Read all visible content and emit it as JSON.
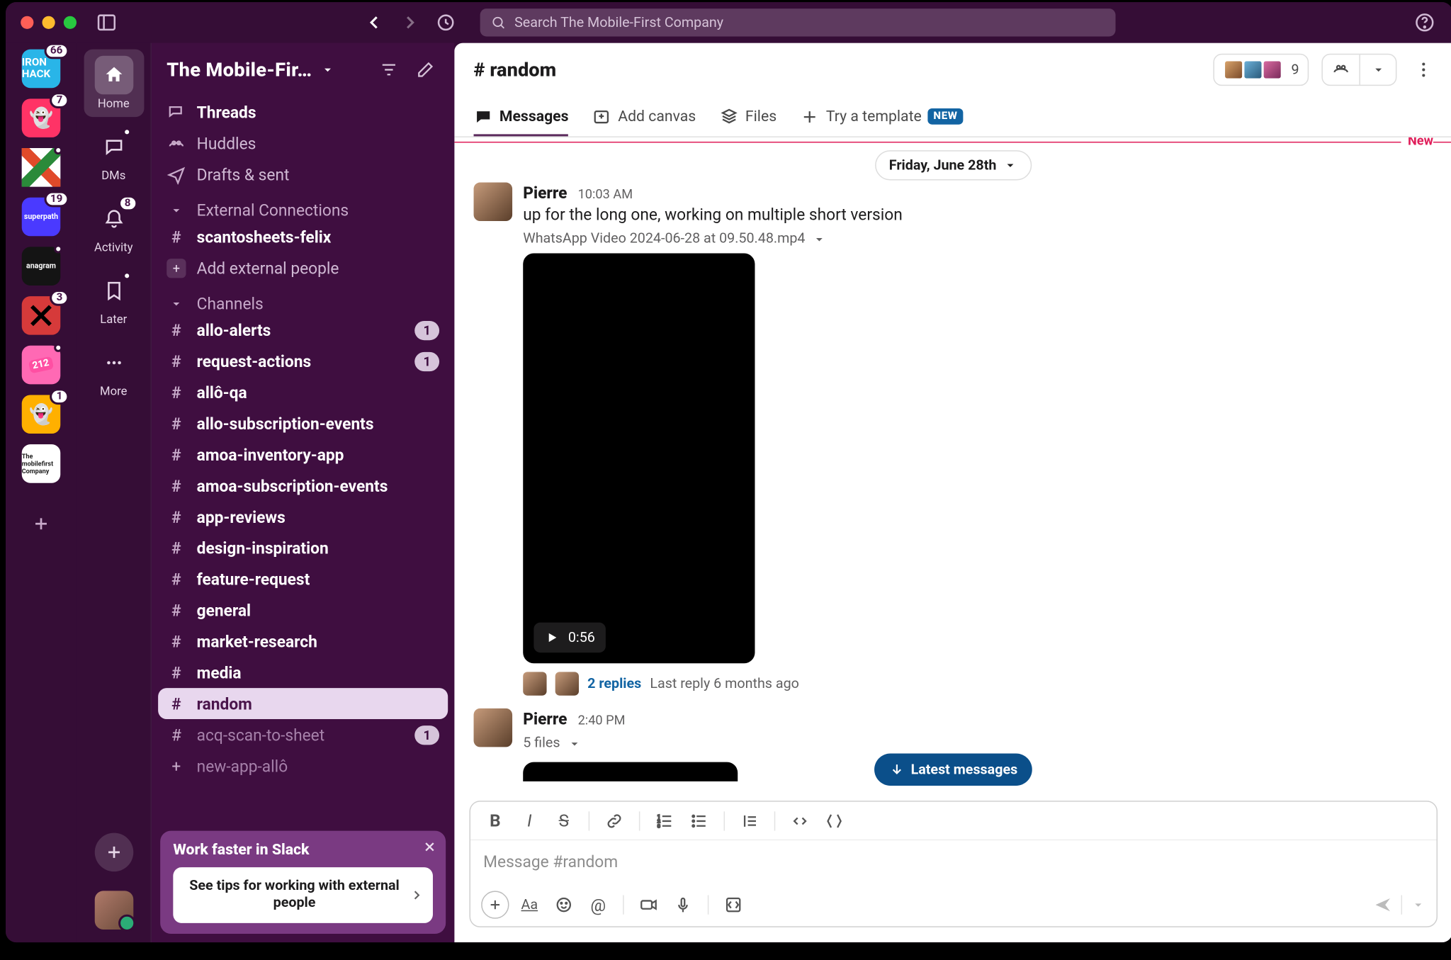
{
  "toolbar": {
    "search_placeholder": "Search The Mobile-First Company"
  },
  "workspaces": [
    {
      "label": "IRON HACK",
      "bg": "#29b5e8",
      "count": "66"
    },
    {
      "label": "",
      "bg": "#ff3366",
      "count": "7",
      "emoji": "👻"
    },
    {
      "label": "",
      "bg": "#ffffff",
      "dot": true,
      "stripes": true
    },
    {
      "label": "superpath",
      "bg": "#4a3aff",
      "count": "19",
      "fs": "7"
    },
    {
      "label": "anagram",
      "bg": "#141414",
      "dot": true,
      "fs": "7"
    },
    {
      "label": "",
      "bg": "#d63a3a",
      "count": "3",
      "x": true
    },
    {
      "label": "212",
      "bg": "#ff69b4",
      "dot": true,
      "tilt": true
    },
    {
      "label": "",
      "bg": "#ffb000",
      "count": "1",
      "emoji": "👻"
    },
    {
      "label": "The mobilefirst Company",
      "bg": "#ffffff",
      "fg": "#222",
      "fs": "6"
    }
  ],
  "mini": {
    "home": "Home",
    "dms": "DMs",
    "activity": "Activity",
    "later": "Later",
    "more": "More",
    "activity_count": "8"
  },
  "sidebar": {
    "title": "The Mobile-Fir…",
    "threads": "Threads",
    "huddles": "Huddles",
    "drafts": "Drafts & sent",
    "sec_ext": "External Connections",
    "ext_channel": "scantosheets-felix",
    "add_ext": "Add external people",
    "sec_channels": "Channels",
    "channels": [
      {
        "name": "allo-alerts",
        "bold": true,
        "badge": "1"
      },
      {
        "name": "request-actions",
        "bold": true,
        "badge": "1"
      },
      {
        "name": "allô-qa",
        "bold": true
      },
      {
        "name": "allo-subscription-events",
        "bold": true
      },
      {
        "name": "amoa-inventory-app",
        "bold": true
      },
      {
        "name": "amoa-subscription-events",
        "bold": true
      },
      {
        "name": "app-reviews",
        "bold": true
      },
      {
        "name": "design-inspiration",
        "bold": true
      },
      {
        "name": "feature-request",
        "bold": true
      },
      {
        "name": "general",
        "bold": true
      },
      {
        "name": "market-research",
        "bold": true
      },
      {
        "name": "media",
        "bold": true
      },
      {
        "name": "random",
        "bold": true,
        "selected": true
      },
      {
        "name": "acq-scan-to-sheet",
        "muted": true,
        "badge": "1"
      },
      {
        "name": "new-app-allô",
        "muted": true,
        "add_pre": true
      }
    ],
    "banner": {
      "title": "Work faster in Slack",
      "card": "See tips for working with external people"
    }
  },
  "header": {
    "title": "# random",
    "member_count": "9",
    "tabs": {
      "messages": "Messages",
      "canvas": "Add canvas",
      "files": "Files",
      "template": "Try a template",
      "new": "NEW"
    }
  },
  "thread": {
    "date": "Friday, June 28th",
    "new": "New",
    "latest": "Latest messages",
    "msg1": {
      "author": "Pierre",
      "time": "10:03 AM",
      "text": "up for the long one, working on multiple short version",
      "attachment": "WhatsApp Video 2024-06-28 at 09.50.48.mp4",
      "duration": "0:56",
      "replies": "2 replies",
      "reply_meta": "Last reply 6 months ago"
    },
    "msg2": {
      "author": "Pierre",
      "time": "2:40 PM",
      "files": "5 files"
    }
  },
  "composer": {
    "placeholder": "Message #random"
  }
}
